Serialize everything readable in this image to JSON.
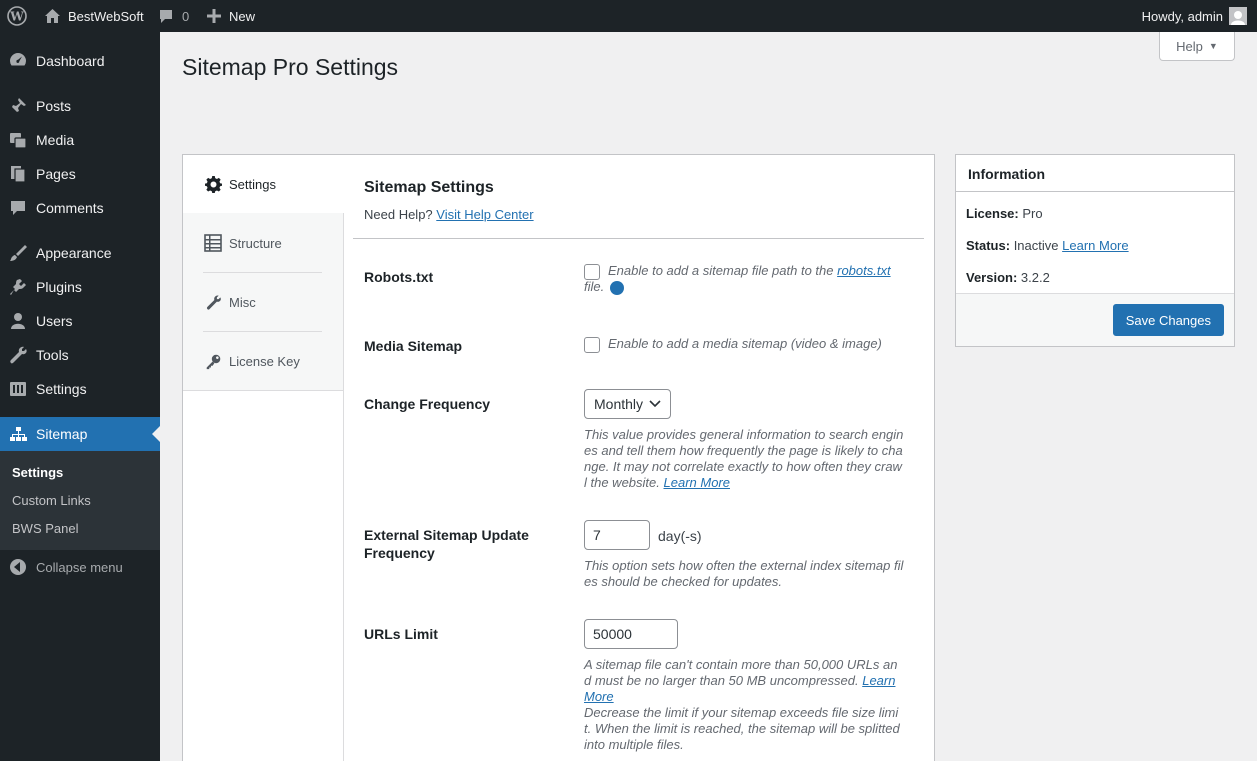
{
  "adminbar": {
    "site_name": "BestWebSoft",
    "comments_count": "0",
    "new_label": "New",
    "howdy": "Howdy, admin"
  },
  "menu": {
    "items": [
      {
        "label": "Dashboard",
        "icon": "dashboard-icon"
      },
      {
        "label": "Posts",
        "icon": "pin-icon"
      },
      {
        "label": "Media",
        "icon": "media-icon"
      },
      {
        "label": "Pages",
        "icon": "pages-icon"
      },
      {
        "label": "Comments",
        "icon": "comment-icon"
      },
      {
        "label": "Appearance",
        "icon": "brush-icon"
      },
      {
        "label": "Plugins",
        "icon": "plugin-icon"
      },
      {
        "label": "Users",
        "icon": "user-icon"
      },
      {
        "label": "Tools",
        "icon": "wrench-icon"
      },
      {
        "label": "Settings",
        "icon": "settings-icon"
      },
      {
        "label": "Sitemap",
        "icon": "sitemap-icon"
      }
    ],
    "submenu": [
      "Settings",
      "Custom Links",
      "BWS Panel"
    ],
    "collapse": "Collapse menu"
  },
  "page": {
    "title": "Sitemap Pro Settings",
    "help_tab": "Help"
  },
  "tabs": [
    {
      "label": "Settings",
      "icon": "gear-icon"
    },
    {
      "label": "Structure",
      "icon": "list-icon"
    },
    {
      "label": "Misc",
      "icon": "wrench-icon"
    },
    {
      "label": "License Key",
      "icon": "key-icon"
    }
  ],
  "section": {
    "title": "Sitemap Settings",
    "need_help": "Need Help?",
    "help_link": "Visit Help Center"
  },
  "fields": {
    "robots": {
      "label": "Robots.txt",
      "desc_before": "Enable to add a sitemap file path to the ",
      "desc_link": "robots.txt",
      "desc_after": " file.",
      "help_icon": "?"
    },
    "media": {
      "label": "Media Sitemap",
      "desc": "Enable to add a media sitemap (video & image)"
    },
    "frequency": {
      "label": "Change Frequency",
      "value": "Monthly",
      "desc": "This value provides general information to search engines and tell them how frequently the page is likely to change. It may not correlate exactly to how often they crawl the website.",
      "link": "Learn More"
    },
    "external": {
      "label": "External Sitemap Update Frequency",
      "value": "7",
      "unit": "day(-s)",
      "desc": "This option sets how often the external index sitemap files should be checked for updates."
    },
    "urls": {
      "label": "URLs Limit",
      "value": "50000",
      "desc": "A sitemap file can't contain more than 50,000 URLs and must be no larger than 50 MB uncompressed.",
      "link": "Learn More",
      "desc2": "Decrease the limit if your sitemap exceeds file size limit. When the limit is reached, the sitemap will be splitted into multiple files."
    }
  },
  "info": {
    "title": "Information",
    "license_label": "License:",
    "license_value": "Pro",
    "status_label": "Status:",
    "status_value": "Inactive",
    "status_link": "Learn More",
    "version_label": "Version:",
    "version_value": "3.2.2",
    "save": "Save Changes"
  }
}
